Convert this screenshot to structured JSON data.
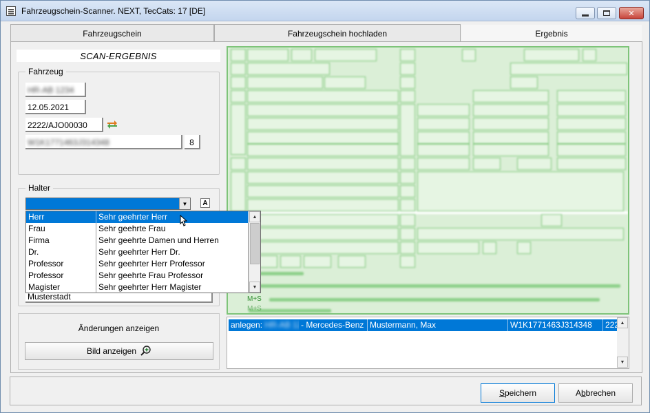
{
  "window": {
    "title": "Fahrzeugschein-Scanner. NEXT, TecCats: 17 [DE]",
    "controls": {
      "minimize": "–",
      "maximize": "□",
      "close": "✕"
    }
  },
  "tabs": [
    {
      "label": "Fahrzeugschein"
    },
    {
      "label": "Fahrzeugschein hochladen"
    },
    {
      "label": "Ergebnis"
    }
  ],
  "scan_title": "SCAN-ERGEBNIS",
  "fahrzeug": {
    "label": "Fahrzeug",
    "field1": "HR-AB 1234",
    "date": "12.05.2021",
    "code": "2222/AJO00030",
    "vin": "W1K1771463J314348",
    "digit": "8"
  },
  "halter": {
    "label": "Halter",
    "dropdown_value": "",
    "font_button": "A",
    "options": [
      {
        "short": "Herr",
        "long": "Sehr geehrter Herr"
      },
      {
        "short": "Frau",
        "long": "Sehr geehrte Frau"
      },
      {
        "short": "Firma",
        "long": "Sehr geehrte Damen und Herren"
      },
      {
        "short": "Dr.",
        "long": "Sehr geehrter Herr Dr."
      },
      {
        "short": "Professor",
        "long": "Sehr geehrter Herr Professor"
      },
      {
        "short": "Professor",
        "long": "Sehr geehrte Frau Professor"
      },
      {
        "short": "Magister",
        "long": "Sehr geehrter Herr Magister"
      }
    ],
    "city": "Musterstadt"
  },
  "changes": {
    "label": "Änderungen anzeigen",
    "bild_button": "Bild anzeigen"
  },
  "preview": {
    "text1": "M+S",
    "text2": "M+S"
  },
  "result": {
    "prefix": "anlegen:",
    "plate": "HR-AB 12",
    "make": "- Mercedes-Benz",
    "owner": "Mustermann, Max",
    "vin": "W1K1771463J314348",
    "extra": "222"
  },
  "footer": {
    "save_label_first": "S",
    "save_label_rest": "peichern",
    "cancel_label_first": "A",
    "cancel_label_b": "b",
    "cancel_label_rest": "brechen"
  },
  "colors": {
    "selection": "#0078d7",
    "preview_green": "#7ec479"
  }
}
